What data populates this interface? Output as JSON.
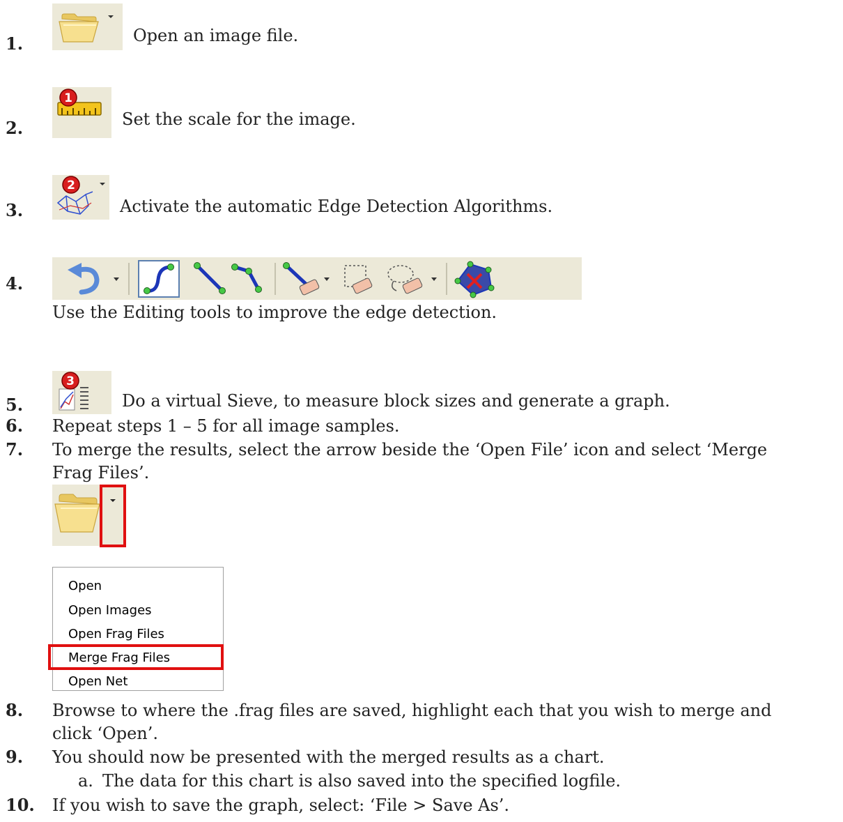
{
  "steps": [
    {
      "num": "1.",
      "text": "Open an image file."
    },
    {
      "num": "2.",
      "text": "Set the scale for the image."
    },
    {
      "num": "3.",
      "text": "Activate the automatic Edge Detection Algorithms."
    },
    {
      "num": "4.",
      "text": "Use the Editing tools to improve the edge detection."
    },
    {
      "num": "5.",
      "text": "Do a virtual Sieve, to measure block sizes and generate a graph."
    },
    {
      "num": "6.",
      "text": "Repeat steps 1 – 5 for all image samples."
    },
    {
      "num": "7.",
      "text_line1": "To merge the results, select the arrow beside the ‘Open File’ icon and select ‘Merge",
      "text_line2": "Frag Files’."
    },
    {
      "num": "8.",
      "text_line1": "Browse to where the .frag files are saved, highlight each that you wish to merge and",
      "text_line2": "click ‘Open’."
    },
    {
      "num": "9.",
      "text": "You should now be presented with the merged results as a chart."
    },
    {
      "num": "10.",
      "text": "If you wish to save the graph, select:  ‘File > Save As’."
    }
  ],
  "sub_step": {
    "letter": "a.",
    "text": "The data for this chart is also saved into the specified logfile."
  },
  "icons": {
    "scale_badge": "1",
    "edge_badge": "2",
    "sieve_badge": "3"
  },
  "menu": {
    "items": [
      "Open",
      "Open Images",
      "Open Frag Files",
      "Merge Frag Files",
      "Open Net"
    ],
    "highlighted_index": 3
  },
  "colors": {
    "highlight": "#e01010",
    "badge": "#d81e1e",
    "toolbar_bg": "#ece9d8"
  }
}
